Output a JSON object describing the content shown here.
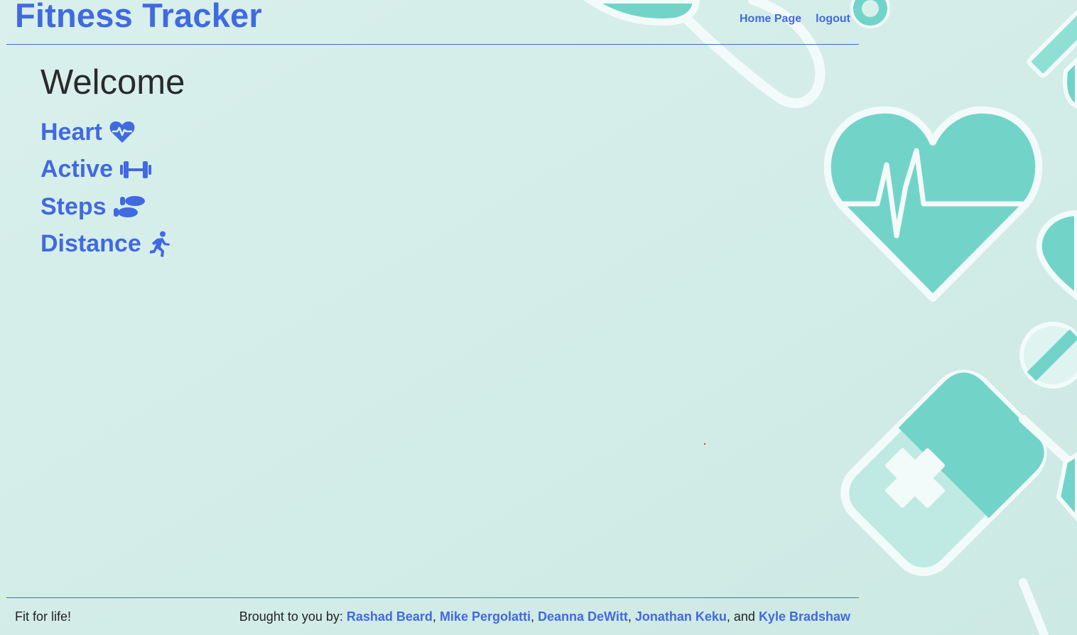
{
  "header": {
    "title": "Fitness Tracker",
    "nav": [
      {
        "label": "Home Page"
      },
      {
        "label": "logout"
      }
    ]
  },
  "main": {
    "heading": "Welcome",
    "links": [
      {
        "label": "Heart",
        "icon": "heart-pulse-icon"
      },
      {
        "label": "Active",
        "icon": "dumbbell-icon"
      },
      {
        "label": "Steps",
        "icon": "shoe-prints-icon"
      },
      {
        "label": "Distance",
        "icon": "running-person-icon"
      }
    ]
  },
  "footer": {
    "tagline": "Fit for life!",
    "credits_prefix": "Brought to you by: ",
    "authors": [
      "Rashad Beard",
      "Mike Pergolatti",
      "Deanna DeWitt",
      "Jonathan Keku",
      "Kyle Bradshaw"
    ],
    "sep": ", ",
    "sep_last": ", and "
  },
  "colors": {
    "accent": "#4169e1",
    "background": "#d8efeb",
    "illustration_teal": "#72d4c8"
  }
}
